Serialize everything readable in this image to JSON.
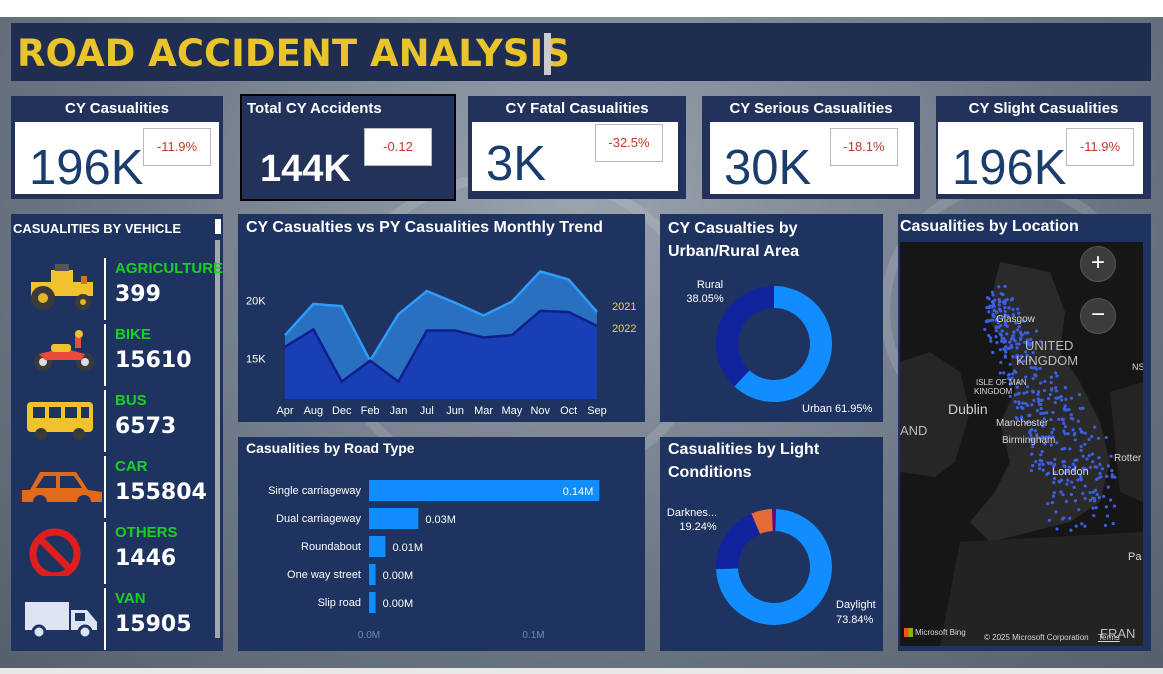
{
  "header": {
    "title": "ROAD ACCIDENT ANALYSIS"
  },
  "kpis": [
    {
      "label": "CY Casualities",
      "value": "196K",
      "delta": "-11.9%"
    },
    {
      "label": "Total CY Accidents",
      "value": "144K",
      "delta": "-0.12"
    },
    {
      "label": "CY Fatal Casualities",
      "value": "3K",
      "delta": "-32.5%"
    },
    {
      "label": "CY Serious Casualities",
      "value": "30K",
      "delta": "-18.1%"
    },
    {
      "label": "CY Slight Casualities",
      "value": "196K",
      "delta": "-11.9%"
    }
  ],
  "vehicles": {
    "title": "CASUALITIES BY VEHICLE",
    "items": [
      {
        "name": "AGRICULTURE",
        "value": "399",
        "icon": "tractor-icon"
      },
      {
        "name": "BIKE",
        "value": "15610",
        "icon": "motorbike-icon"
      },
      {
        "name": "BUS",
        "value": "6573",
        "icon": "bus-icon"
      },
      {
        "name": "CAR",
        "value": "155804",
        "icon": "car-icon"
      },
      {
        "name": "OTHERS",
        "value": "1446",
        "icon": "prohibited-icon"
      },
      {
        "name": "VAN",
        "value": "15905",
        "icon": "van-icon"
      }
    ]
  },
  "trend": {
    "title": "CY Casualties vs PY Casualities Monthly Trend",
    "chart_data": {
      "type": "area",
      "categories": [
        "Apr",
        "Aug",
        "Dec",
        "Feb",
        "Jan",
        "Jul",
        "Jun",
        "Mar",
        "May",
        "Nov",
        "Oct",
        "Sep"
      ],
      "series": [
        {
          "name": "2021",
          "values": [
            17000,
            19700,
            19500,
            14800,
            18800,
            20800,
            19800,
            18700,
            19900,
            22500,
            21800,
            19000
          ]
        },
        {
          "name": "2022",
          "values": [
            16000,
            17500,
            13000,
            14800,
            13000,
            17400,
            17400,
            16800,
            17000,
            19100,
            19000,
            17800
          ]
        }
      ],
      "yticks": [
        "20K",
        "15K"
      ],
      "ytick_values": [
        20000,
        15000
      ],
      "ylim": [
        11500,
        24000
      ],
      "colors": {
        "2021": "#2f86e0",
        "2022": "#1636b5"
      }
    }
  },
  "road": {
    "title": "Casualities by Road Type",
    "chart_data": {
      "type": "bar",
      "orientation": "horizontal",
      "categories": [
        "Single carriageway",
        "Dual carriageway",
        "Roundabout",
        "One way street",
        "Slip road"
      ],
      "values": [
        0.14,
        0.03,
        0.01,
        0.004,
        0.004
      ],
      "labels": [
        "0.14M",
        "0.03M",
        "0.01M",
        "0.00M",
        "0.00M"
      ],
      "xticks": [
        "0.0M",
        "0.1M"
      ],
      "xtick_values": [
        0,
        0.1
      ],
      "xlim": [
        0,
        0.155
      ],
      "color": "#118dff"
    }
  },
  "urban": {
    "title": "CY Casualties by Urban/Rural Area",
    "chart_data": {
      "type": "pie",
      "slices": [
        {
          "name": "Urban",
          "value": 61.95,
          "label": "Urban 61.95%",
          "color": "#118dff"
        },
        {
          "name": "Rural",
          "value": 38.05,
          "label": "Rural",
          "pct": "38.05%",
          "color": "#12239e"
        }
      ]
    }
  },
  "light": {
    "title": "Casualities by Light Conditions",
    "chart_data": {
      "type": "pie",
      "slices": [
        {
          "name": "Daylight",
          "value": 73.84,
          "label": "Daylight",
          "pct": "73.84%",
          "color": "#118dff"
        },
        {
          "name": "Darkness",
          "value": 19.24,
          "label": "Darknes...",
          "pct": "19.24%",
          "color": "#12239e"
        },
        {
          "name": "Other1",
          "value": 5.8,
          "color": "#e66c37"
        },
        {
          "name": "Other2",
          "value": 1.12,
          "color": "#6b007b"
        }
      ]
    }
  },
  "location": {
    "title": "Casualities by Location",
    "zoom_in": "+",
    "zoom_out": "−",
    "labels": {
      "uk": "UNITED",
      "kingdom": "KINGDOM",
      "dublin": "Dublin",
      "isle": "ISLE OF MAN",
      "kingdom2": "KINGDOM",
      "and": "AND",
      "glasgow": "Glasgow",
      "manchester": "Manchester",
      "birmingham": "Birmingham",
      "london": "London",
      "rotterdam": "Rotter",
      "fran": "FRAN",
      "pa": "Pa",
      "ns": "NS"
    },
    "attribution": "Microsoft Bing",
    "copyright": "© 2025 Microsoft Corporation",
    "terms": "Terms"
  }
}
